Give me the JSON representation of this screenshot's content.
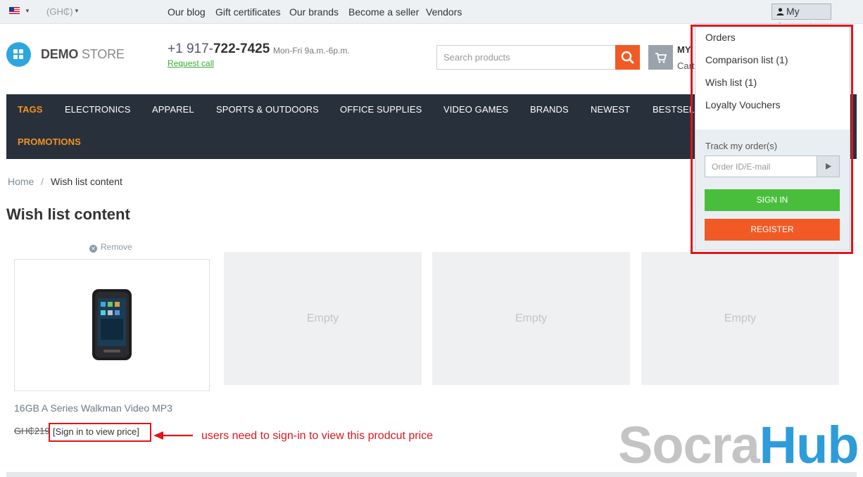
{
  "topbar": {
    "currency": "(GH₵)",
    "links": [
      "Our blog",
      "Gift certificates",
      "Our brands",
      "Become a seller",
      "Vendors"
    ],
    "account_label": "My Account"
  },
  "header": {
    "logo_bold": "DEMO",
    "logo_light": "STORE",
    "phone_prefix": "+1 917-",
    "phone_main": "722-7425",
    "hours": "Mon-Fri 9a.m.-6p.m.",
    "request_call": "Request call",
    "search_placeholder": "Search products",
    "cart_title": "MY",
    "cart_sub": "Cart"
  },
  "nav": {
    "items": [
      "TAGS",
      "ELECTRONICS",
      "APPAREL",
      "SPORTS & OUTDOORS",
      "OFFICE SUPPLIES",
      "VIDEO GAMES",
      "BRANDS",
      "NEWEST",
      "BESTSEL"
    ],
    "second_row": "PROMOTIONS"
  },
  "breadcrumb": {
    "home": "Home",
    "separator": "/",
    "current": "Wish list content"
  },
  "page_title": "Wish list content",
  "wishlist": {
    "remove_label": "Remove",
    "product_name": "16GB A Series Walkman Video MP3",
    "old_price": "GH₵219",
    "sign_in_price": "[Sign in to view price]",
    "empty_label": "Empty"
  },
  "annotation": "users need to sign-in to view this prodcut price",
  "dropdown": {
    "items": [
      "Orders",
      "Comparison list (1)",
      "Wish list (1)",
      "Loyalty Vouchers"
    ],
    "track_label": "Track my order(s)",
    "track_placeholder": "Order ID/E-mail",
    "signin_label": "SIGN IN",
    "register_label": "REGISTER"
  },
  "watermark": {
    "part1": "Socra",
    "part2": "Hub"
  },
  "colors": {
    "accent": "#f15a24",
    "nav_bg": "#28313b",
    "green": "#49be3c",
    "highlight": "#e0151d",
    "brand_blue": "#2ba6de"
  }
}
